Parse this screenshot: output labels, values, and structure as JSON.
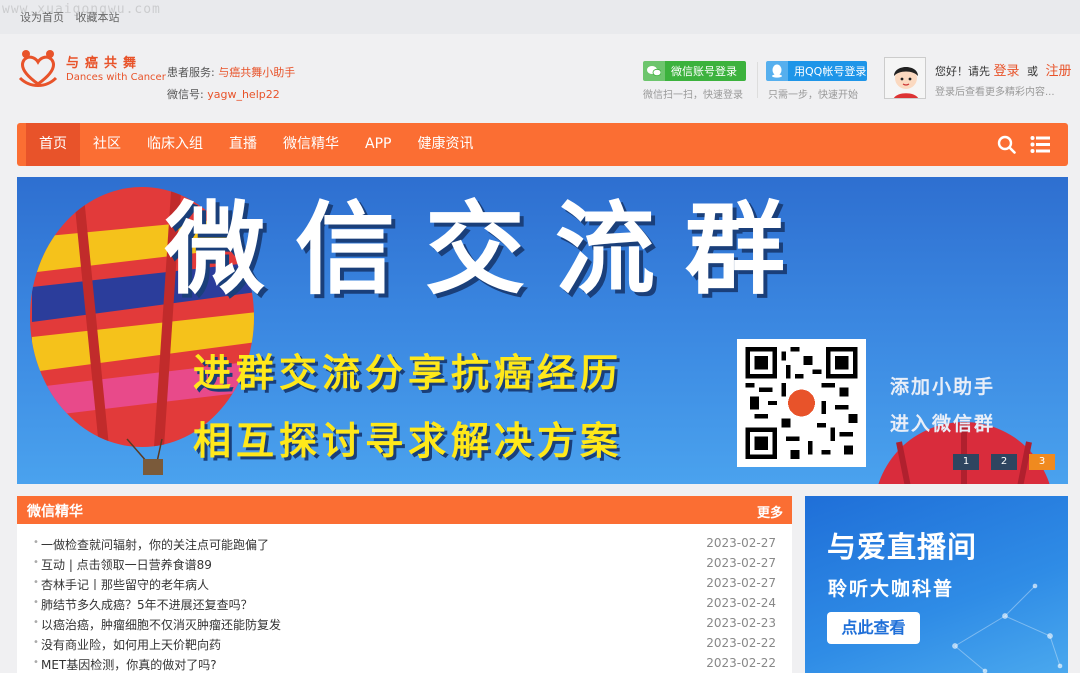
{
  "topbar": {
    "set_home": "设为首页",
    "bookmark": "收藏本站",
    "watermark": "www.xuaigongwu.com"
  },
  "logo": {
    "cn": "与癌共舞",
    "en": "Dances with Cancer"
  },
  "service": {
    "label": "患者服务:",
    "value": "与癌共舞小助手",
    "wechat_label": "微信号:",
    "wechat_value": "yagw_help22"
  },
  "login": {
    "wechat_button": "微信账号登录",
    "wechat_sub": "微信扫一扫，快速登录",
    "qq_button": "用QQ帐号登录",
    "qq_sub": "只需一步，快速开始",
    "hello": "您好！请先",
    "login_link": "登录",
    "or": "或",
    "register_link": "注册",
    "hint": "登录后查看更多精彩内容..."
  },
  "nav": {
    "items": [
      "首页",
      "社区",
      "临床入组",
      "直播",
      "微信精华",
      "APP",
      "健康资讯"
    ]
  },
  "banner": {
    "title": "微信交流群",
    "line1": "进群交流分享抗癌经历",
    "line2": "相互探讨寻求解决方案",
    "side1": "添加小助手",
    "side2": "进入微信群",
    "dots": [
      "1",
      "2",
      "3"
    ],
    "active_dot": 3
  },
  "news": {
    "title": "微信精华",
    "more": "更多",
    "items": [
      {
        "title": "一做检查就问辐射，你的关注点可能跑偏了",
        "date": "2023-02-27"
      },
      {
        "title": "互动 | 点击领取一日营养食谱89",
        "date": "2023-02-27"
      },
      {
        "title": "杏林手记丨那些留守的老年病人",
        "date": "2023-02-27"
      },
      {
        "title": "肺结节多久成癌？5年不进展还复查吗？",
        "date": "2023-02-24"
      },
      {
        "title": "以癌治癌，肿瘤细胞不仅消灭肿瘤还能防复发",
        "date": "2023-02-23"
      },
      {
        "title": "没有商业险，如何用上天价靶向药",
        "date": "2023-02-22"
      },
      {
        "title": "MET基因检测，你真的做对了吗?",
        "date": "2023-02-22"
      }
    ]
  },
  "live": {
    "title": "与爱直播间",
    "subtitle": "聆听大咖科普",
    "button": "点此查看"
  },
  "colors": {
    "accent": "#fb6e33",
    "accent_dark": "#e8532a",
    "wechat_green": "#3cb23d",
    "qq_blue": "#1e95e8"
  }
}
